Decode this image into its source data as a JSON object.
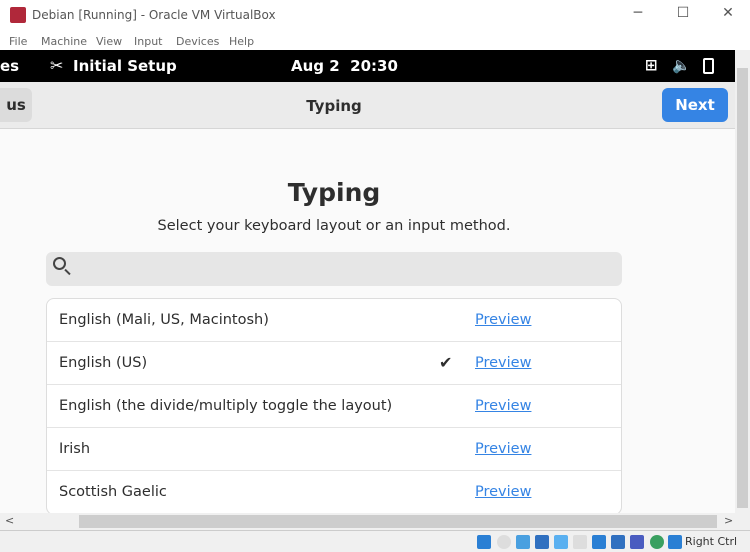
{
  "window": {
    "title": "Debian [Running] - Oracle VM VirtualBox"
  },
  "menu": [
    "File",
    "Machine",
    "View",
    "Input",
    "Devices",
    "Help"
  ],
  "topbar": {
    "activities_partial": "es",
    "app": "Initial Setup",
    "datetime": "Aug 2  20:30"
  },
  "header": {
    "back_partial": "us",
    "title": "Typing",
    "next": "Next"
  },
  "page": {
    "heading": "Typing",
    "subtitle": "Select your keyboard layout or an input method.",
    "search_placeholder": ""
  },
  "layouts": [
    {
      "label": "English (Mali, US, Macintosh)",
      "preview": "Preview",
      "selected": false
    },
    {
      "label": "English (US)",
      "preview": "Preview",
      "selected": true
    },
    {
      "label": "English (the divide/multiply toggle the layout)",
      "preview": "Preview",
      "selected": false
    },
    {
      "label": "Irish",
      "preview": "Preview",
      "selected": false
    },
    {
      "label": "Scottish Gaelic",
      "preview": "Preview",
      "selected": false
    }
  ],
  "status": {
    "host_key": "Right Ctrl"
  },
  "colors": {
    "accent": "#3584e4",
    "topbar": "#000000"
  }
}
